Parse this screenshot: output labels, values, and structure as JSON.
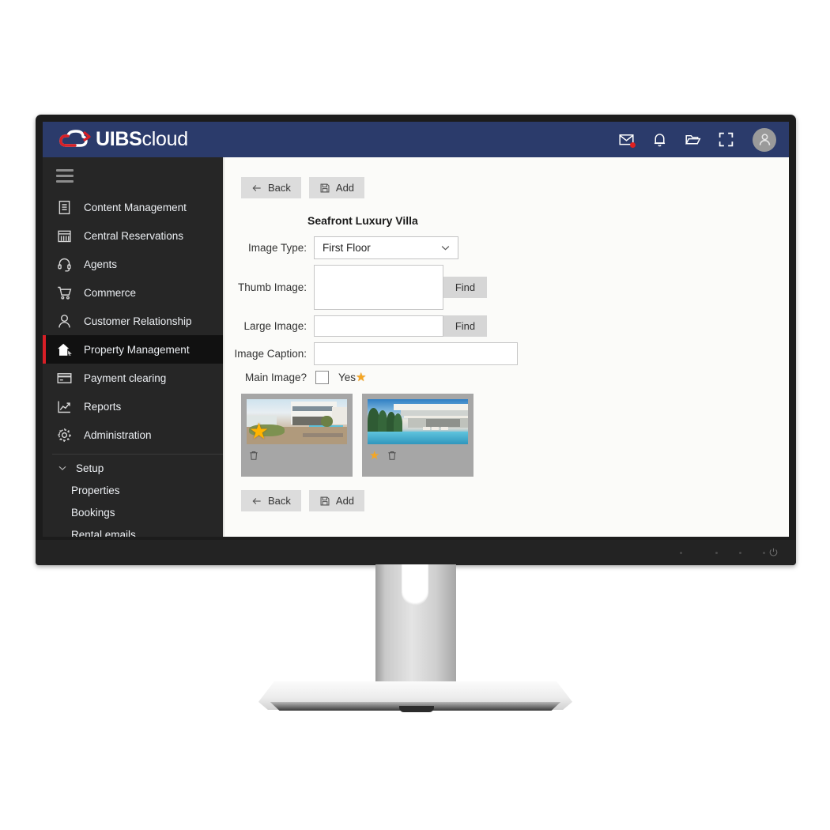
{
  "app": {
    "logo_bold": "UIBS",
    "logo_light": "cloud",
    "header_icons": [
      {
        "name": "mail-icon",
        "label": "Messages",
        "badge": true
      },
      {
        "name": "bell-icon",
        "label": "Notifications",
        "badge": false
      },
      {
        "name": "folder-icon",
        "label": "Files",
        "badge": false
      },
      {
        "name": "fullscreen-icon",
        "label": "Fullscreen",
        "badge": false
      }
    ],
    "avatar_label": "User account"
  },
  "sidebar": {
    "menu_toggle_label": "Menu",
    "items": [
      {
        "label": "Content Management",
        "icon": "document-icon",
        "active": false
      },
      {
        "label": "Central Reservations",
        "icon": "calendar-icon",
        "active": false
      },
      {
        "label": "Agents",
        "icon": "headset-icon",
        "active": false
      },
      {
        "label": "Commerce",
        "icon": "cart-icon",
        "active": false
      },
      {
        "label": "Customer Relationship",
        "icon": "person-icon",
        "active": false
      },
      {
        "label": "Property Management",
        "icon": "home-icon",
        "active": true
      },
      {
        "label": "Payment clearing",
        "icon": "card-icon",
        "active": false
      },
      {
        "label": "Reports",
        "icon": "chart-icon",
        "active": false
      },
      {
        "label": "Administration",
        "icon": "gear-icon",
        "active": false
      }
    ],
    "sub_items": [
      {
        "label": "Setup",
        "chevron": true
      },
      {
        "label": "Properties",
        "chevron": false
      },
      {
        "label": "Bookings",
        "chevron": false
      },
      {
        "label": "Rental emails",
        "chevron": false
      }
    ]
  },
  "content": {
    "toolbar_top": {
      "back_label": "Back",
      "add_label": "Add"
    },
    "toolbar_bottom": {
      "back_label": "Back",
      "add_label": "Add"
    },
    "property_title": "Seafront Luxury Villa",
    "form": {
      "image_type_label": "Image Type:",
      "image_type_value": "First Floor",
      "thumb_image_label": "Thumb Image:",
      "thumb_image_value": "",
      "thumb_image_placeholder": "",
      "thumb_find_label": "Find",
      "large_image_label": "Large Image:",
      "large_image_value": "",
      "large_image_placeholder": "",
      "large_find_label": "Find",
      "image_caption_label": "Image Caption:",
      "image_caption_value": "",
      "image_caption_placeholder": "",
      "main_image_label": "Main Image?",
      "main_image_checked": false,
      "main_image_yes_label": "Yes",
      "main_image_star": "★"
    },
    "image_cards": [
      {
        "name": "image-card-1",
        "star": "★",
        "star_position": "overlay",
        "delete_label": "Delete"
      },
      {
        "name": "image-card-2",
        "star": "★",
        "star_position": "below",
        "delete_label": "Delete"
      }
    ]
  },
  "monitor": {
    "power_label": "Power",
    "bezel_dot_count": 4
  },
  "colors": {
    "header_blue": "#2b3b6b",
    "sidebar_dark": "#262626",
    "active_red": "#d81f26",
    "content_bg": "#fbfbf9",
    "star_gold": "#f5a623",
    "badge_red": "#e02020"
  }
}
